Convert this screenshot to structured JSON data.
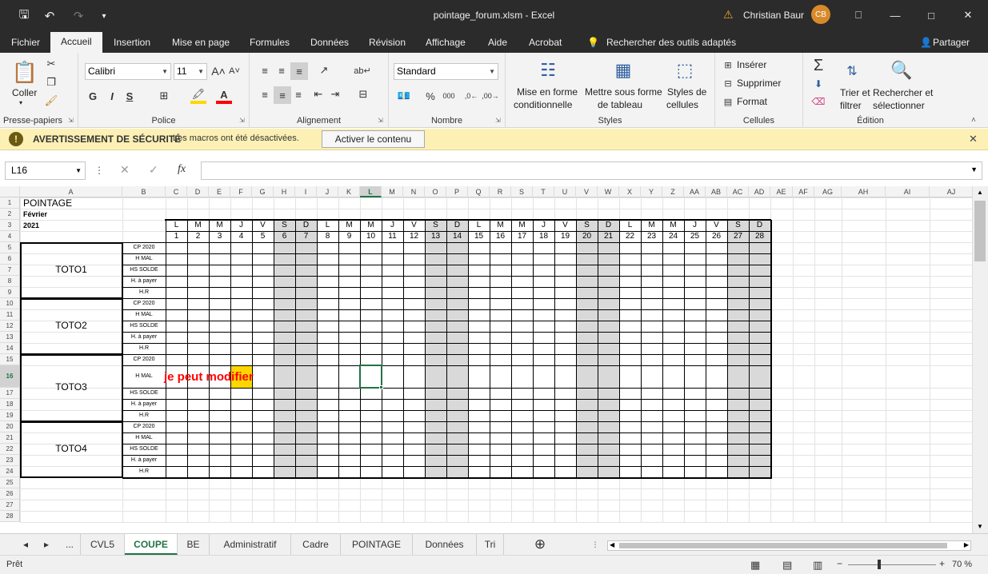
{
  "window": {
    "title": "pointage_forum.xlsm  -  Excel",
    "user": "Christian Baur",
    "avatar_initials": "CB",
    "icons": [
      "save-icon",
      "undo-icon",
      "redo-icon",
      "customize-icon",
      "warning-icon",
      "ribbon-display-icon",
      "minimize-icon",
      "maximize-icon",
      "close-icon"
    ]
  },
  "menu": {
    "items": [
      "Fichier",
      "Accueil",
      "Insertion",
      "Mise en page",
      "Formules",
      "Données",
      "Révision",
      "Affichage",
      "Aide",
      "Acrobat"
    ],
    "active": "Accueil",
    "search_placeholder": "Rechercher des outils adaptés",
    "share": "Partager"
  },
  "ribbon": {
    "clipboard": {
      "label": "Presse-papiers",
      "paste": "Coller"
    },
    "font": {
      "label": "Police",
      "name": "Calibri",
      "size": "11",
      "bold": "G",
      "italic": "I",
      "underline": "S"
    },
    "alignment": {
      "label": "Alignement"
    },
    "number": {
      "label": "Nombre",
      "format": "Standard"
    },
    "styles": {
      "label": "Styles",
      "cond1": "Mise en forme",
      "cond2": "conditionnelle",
      "table1": "Mettre sous forme",
      "table2": "de tableau",
      "cell1": "Styles de",
      "cell2": "cellules"
    },
    "cells": {
      "label": "Cellules",
      "insert": "Insérer",
      "delete": "Supprimer",
      "format": "Format"
    },
    "editing": {
      "label": "Édition",
      "sort1": "Trier et",
      "sort2": "filtrer",
      "find1": "Rechercher et",
      "find2": "sélectionner"
    }
  },
  "security": {
    "title": "AVERTISSEMENT DE SÉCURITÉ",
    "message": "Les macros ont été désactivées.",
    "button": "Activer le contenu"
  },
  "formula": {
    "namebox": "L16",
    "value": "",
    "fx": "fx"
  },
  "sheet": {
    "columns": [
      "A",
      "B",
      "C",
      "D",
      "E",
      "F",
      "G",
      "H",
      "I",
      "J",
      "K",
      "L",
      "M",
      "N",
      "O",
      "P",
      "Q",
      "R",
      "S",
      "T",
      "U",
      "V",
      "W",
      "X",
      "Y",
      "Z",
      "AA",
      "AB",
      "AC",
      "AD",
      "AE",
      "AF",
      "AG",
      "AH",
      "AI",
      "AJ"
    ],
    "selected_column": "L",
    "rows": [
      "1",
      "2",
      "3",
      "4",
      "5",
      "6",
      "7",
      "8",
      "9",
      "10",
      "11",
      "12",
      "13",
      "14",
      "15",
      "16",
      "17",
      "18",
      "19",
      "20",
      "21",
      "22",
      "23",
      "24",
      "25",
      "26",
      "27",
      "28"
    ],
    "selected_row": "16",
    "title": "POINTAGE",
    "month": "Février 2021",
    "weekdays": [
      "L",
      "M",
      "M",
      "J",
      "V",
      "S",
      "D",
      "L",
      "M",
      "M",
      "J",
      "V",
      "S",
      "D",
      "L",
      "M",
      "M",
      "J",
      "V",
      "S",
      "D",
      "L",
      "M",
      "M",
      "J",
      "V",
      "S",
      "D"
    ],
    "days": [
      "1",
      "2",
      "3",
      "4",
      "5",
      "6",
      "7",
      "8",
      "9",
      "10",
      "11",
      "12",
      "13",
      "14",
      "15",
      "16",
      "17",
      "18",
      "19",
      "20",
      "21",
      "22",
      "23",
      "24",
      "25",
      "26",
      "27",
      "28"
    ],
    "employees": [
      {
        "name": "TOTO1",
        "labels": [
          "CP 2020",
          "H MAL",
          "HS SOLDE",
          "H. à payer",
          "H.R"
        ]
      },
      {
        "name": "TOTO2",
        "labels": [
          "CP 2020",
          "H MAL",
          "HS SOLDE",
          "H. à payer",
          "H.R"
        ]
      },
      {
        "name": "TOTO3",
        "labels": [
          "CP 2020",
          "H MAL",
          "HS SOLDE",
          "H. à payer",
          "H.R"
        ]
      },
      {
        "name": "TOTO4",
        "labels": [
          "CP 2020",
          "H MAL",
          "HS SOLDE",
          "H. à payer",
          "H.R"
        ]
      }
    ],
    "note": "je peut modifier",
    "note_color": "#ff0000",
    "highlight_color": "#ffd700"
  },
  "tabs": {
    "items": [
      "...",
      "CVL5",
      "COUPE",
      "BE",
      "Administratif",
      "Cadre",
      "POINTAGE",
      "Données",
      "Tri"
    ],
    "active": "COUPE"
  },
  "status": {
    "ready": "Prêt",
    "zoom": "70 %"
  }
}
